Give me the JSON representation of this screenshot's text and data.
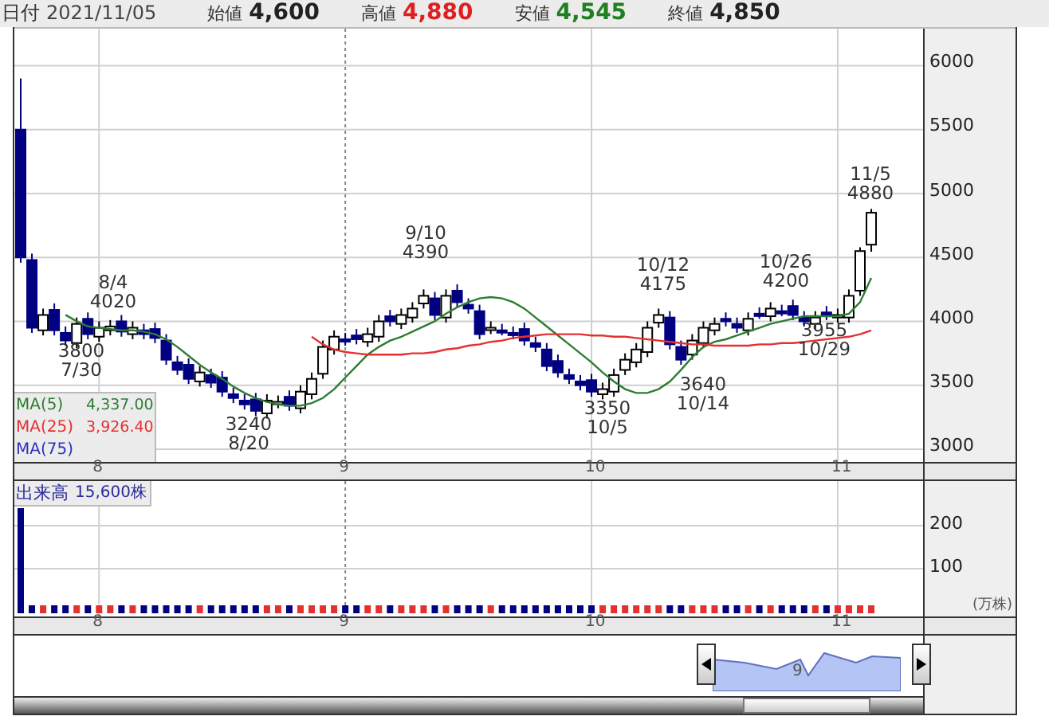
{
  "header": {
    "date_label": "日付",
    "date": "2021/11/05",
    "quotes": [
      {
        "label": "始値",
        "value": "4,600",
        "kind": "open"
      },
      {
        "label": "高値",
        "value": "4,880",
        "kind": "high"
      },
      {
        "label": "安値",
        "value": "4,545",
        "kind": "low"
      },
      {
        "label": "終値",
        "value": "4,850",
        "kind": "close"
      }
    ]
  },
  "price_chart": {
    "chart_data": {
      "type": "candlestick",
      "categories": [
        null,
        null,
        null,
        null,
        null,
        null,
        null,
        "8",
        null,
        null,
        null,
        null,
        null,
        null,
        null,
        null,
        null,
        null,
        null,
        null,
        null,
        null,
        null,
        null,
        null,
        null,
        null,
        null,
        null,
        "9",
        null,
        null,
        null,
        null,
        null,
        null,
        null,
        null,
        null,
        null,
        null,
        null,
        null,
        null,
        null,
        null,
        null,
        null,
        null,
        null,
        null,
        "10",
        null,
        null,
        null,
        null,
        null,
        null,
        null,
        null,
        null,
        null,
        null,
        null,
        null,
        null,
        null,
        null,
        null,
        null,
        null,
        null,
        null,
        "11",
        null,
        null,
        null
      ],
      "ylim": [
        2900,
        6290
      ],
      "grid": true,
      "yticks": [
        3000,
        3500,
        4000,
        4500,
        5000,
        5500,
        6000
      ],
      "ohlc": [
        [
          5500,
          5900,
          4460,
          4500
        ],
        [
          4480,
          4530,
          3910,
          3950
        ],
        [
          3930,
          4100,
          3890,
          4050
        ],
        [
          4090,
          4140,
          3890,
          3930
        ],
        [
          3910,
          3960,
          3810,
          3850
        ],
        [
          3830,
          4030,
          3790,
          3980
        ],
        [
          4020,
          4070,
          3860,
          3900
        ],
        [
          3880,
          4000,
          3840,
          3950
        ],
        [
          3930,
          4010,
          3890,
          3960
        ],
        [
          4000,
          4050,
          3880,
          3920
        ],
        [
          3900,
          4000,
          3860,
          3950
        ],
        [
          3930,
          3980,
          3860,
          3900
        ],
        [
          3940,
          3990,
          3830,
          3870
        ],
        [
          3850,
          3900,
          3660,
          3700
        ],
        [
          3680,
          3730,
          3580,
          3620
        ],
        [
          3660,
          3710,
          3510,
          3550
        ],
        [
          3530,
          3650,
          3490,
          3600
        ],
        [
          3580,
          3630,
          3480,
          3520
        ],
        [
          3560,
          3610,
          3410,
          3450
        ],
        [
          3430,
          3480,
          3360,
          3400
        ],
        [
          3380,
          3430,
          3310,
          3350
        ],
        [
          3390,
          3440,
          3260,
          3300
        ],
        [
          3280,
          3430,
          3240,
          3380
        ],
        [
          3360,
          3420,
          3320,
          3370
        ],
        [
          3410,
          3460,
          3300,
          3340
        ],
        [
          3320,
          3500,
          3280,
          3450
        ],
        [
          3430,
          3600,
          3390,
          3550
        ],
        [
          3590,
          3850,
          3550,
          3800
        ],
        [
          3780,
          3930,
          3740,
          3880
        ],
        [
          3860,
          3910,
          3810,
          3850
        ],
        [
          3890,
          3940,
          3820,
          3860
        ],
        [
          3840,
          3950,
          3800,
          3900
        ],
        [
          3880,
          4050,
          3840,
          4000
        ],
        [
          4040,
          4090,
          3960,
          4000
        ],
        [
          3980,
          4100,
          3940,
          4050
        ],
        [
          4030,
          4150,
          3990,
          4100
        ],
        [
          4140,
          4250,
          4100,
          4200
        ],
        [
          4180,
          4230,
          4010,
          4050
        ],
        [
          4030,
          4250,
          3990,
          4200
        ],
        [
          4240,
          4290,
          4110,
          4150
        ],
        [
          4130,
          4180,
          4060,
          4100
        ],
        [
          4080,
          4130,
          3860,
          3900
        ],
        [
          3940,
          4000,
          3900,
          3950
        ],
        [
          3930,
          3980,
          3890,
          3930
        ],
        [
          3910,
          3960,
          3860,
          3900
        ],
        [
          3940,
          3990,
          3810,
          3850
        ],
        [
          3830,
          3880,
          3760,
          3800
        ],
        [
          3780,
          3830,
          3610,
          3650
        ],
        [
          3690,
          3740,
          3560,
          3600
        ],
        [
          3580,
          3630,
          3510,
          3550
        ],
        [
          3530,
          3580,
          3460,
          3500
        ],
        [
          3540,
          3590,
          3410,
          3450
        ],
        [
          3430,
          3520,
          3390,
          3470
        ],
        [
          3450,
          3630,
          3410,
          3580
        ],
        [
          3620,
          3750,
          3580,
          3700
        ],
        [
          3680,
          3830,
          3640,
          3780
        ],
        [
          3760,
          4000,
          3720,
          3950
        ],
        [
          3990,
          4100,
          3950,
          4050
        ],
        [
          4030,
          4080,
          3780,
          3820
        ],
        [
          3800,
          3850,
          3660,
          3700
        ],
        [
          3740,
          3900,
          3700,
          3850
        ],
        [
          3830,
          4000,
          3790,
          3950
        ],
        [
          3930,
          4030,
          3890,
          3980
        ],
        [
          4020,
          4070,
          3960,
          4000
        ],
        [
          3980,
          4030,
          3910,
          3950
        ],
        [
          3930,
          4070,
          3890,
          4020
        ],
        [
          4060,
          4110,
          4020,
          4060
        ],
        [
          4040,
          4150,
          4000,
          4100
        ],
        [
          4080,
          4130,
          4040,
          4080
        ],
        [
          4120,
          4170,
          4010,
          4050
        ],
        [
          4030,
          4080,
          3960,
          4000
        ],
        [
          3980,
          4080,
          3940,
          4030
        ],
        [
          4070,
          4120,
          4010,
          4050
        ],
        [
          4030,
          4100,
          3990,
          4050
        ],
        [
          4030,
          4250,
          3990,
          4200
        ],
        [
          4240,
          4580,
          4200,
          4550
        ],
        [
          4600,
          4880,
          4545,
          4850
        ]
      ],
      "series": [
        {
          "name": "MA(5)",
          "type": "line",
          "color": "#2e7d32",
          "values": [
            null,
            null,
            null,
            null,
            4050,
            4000,
            3960,
            3950,
            3940,
            3930,
            3930,
            3920,
            3900,
            3860,
            3800,
            3730,
            3660,
            3600,
            3550,
            3490,
            3440,
            3400,
            3370,
            3350,
            3340,
            3340,
            3360,
            3400,
            3470,
            3560,
            3650,
            3740,
            3800,
            3850,
            3880,
            3920,
            3960,
            4000,
            4060,
            4110,
            4150,
            4180,
            4190,
            4180,
            4150,
            4100,
            4030,
            3960,
            3890,
            3820,
            3750,
            3680,
            3600,
            3530,
            3470,
            3440,
            3440,
            3470,
            3530,
            3620,
            3720,
            3800,
            3840,
            3860,
            3890,
            3920,
            3950,
            3980,
            4000,
            4020,
            4040,
            4040,
            4040,
            4040,
            4060,
            4150,
            4340
          ]
        },
        {
          "name": "MA(25)",
          "type": "line",
          "color": "#e53030",
          "values": [
            null,
            null,
            null,
            null,
            null,
            null,
            null,
            null,
            null,
            null,
            null,
            null,
            null,
            null,
            null,
            null,
            null,
            null,
            null,
            null,
            null,
            null,
            null,
            null,
            null,
            null,
            3880,
            3820,
            3780,
            3760,
            3750,
            3740,
            3740,
            3740,
            3740,
            3750,
            3750,
            3760,
            3780,
            3790,
            3810,
            3820,
            3840,
            3850,
            3870,
            3880,
            3890,
            3900,
            3900,
            3900,
            3900,
            3890,
            3890,
            3880,
            3880,
            3870,
            3860,
            3850,
            3840,
            3830,
            3820,
            3820,
            3810,
            3810,
            3810,
            3810,
            3820,
            3820,
            3830,
            3830,
            3840,
            3850,
            3860,
            3870,
            3880,
            3900,
            3930
          ]
        }
      ]
    },
    "annotations": [
      {
        "lines": [
          "8/4",
          "4020"
        ]
      },
      {
        "lines": [
          "3800",
          "7/30"
        ]
      },
      {
        "lines": [
          "9/10",
          "4390"
        ]
      },
      {
        "lines": [
          "3240",
          "8/20"
        ]
      },
      {
        "lines": [
          "10/12",
          "4175"
        ]
      },
      {
        "lines": [
          "3350",
          "10/5"
        ]
      },
      {
        "lines": [
          "3640",
          "10/14"
        ]
      },
      {
        "lines": [
          "10/26",
          "4200"
        ]
      },
      {
        "lines": [
          "3955",
          "10/29"
        ]
      },
      {
        "lines": [
          "11/5",
          "4880"
        ]
      }
    ],
    "legend": [
      {
        "value": "4,337.00"
      },
      {
        "value": "3,926.40"
      },
      {
        "label": "MA(75)",
        "color": "#3030c0"
      }
    ]
  },
  "volume": {
    "label": "出来高",
    "value": "15,600株",
    "yticks": [
      "200",
      "100"
    ],
    "unit": "(万株)"
  },
  "volume_xaxis": [
    "8",
    "9",
    "10",
    "11"
  ],
  "navigator": {
    "label": "9"
  }
}
